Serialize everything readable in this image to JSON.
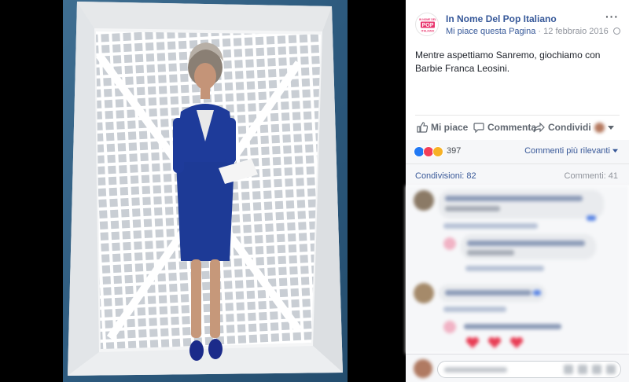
{
  "post": {
    "page_name": "In Nome Del Pop Italiano",
    "like_page": "Mi piace questa Pagina",
    "date": "12 febbraio 2016",
    "text_line1": "Mentre aspettiamo Sanremo, giochiamo con",
    "text_line2": "Barbie Franca Leosini.",
    "logo_lines": [
      "IN NOME DEL",
      "POP",
      "ITALIANO"
    ]
  },
  "actions": {
    "like": "Mi piace",
    "comment": "Commenta",
    "share": "Condividi"
  },
  "reactions": {
    "count": "397",
    "sort_label": "Commenti più rilevanti",
    "shares": "Condivisioni: 82",
    "comments": "Commenti: 41"
  },
  "icons": {
    "more": "more-options-icon",
    "like": "thumbs-up-icon",
    "comment": "speech-bubble-icon",
    "share": "share-arrow-icon",
    "audience": "globe-icon"
  },
  "colors": {
    "link_blue": "#365899",
    "panel_bg": "#f6f7f9",
    "like_blue": "#2078f4",
    "love_red": "#f33e58",
    "haha_yellow": "#f7b125",
    "logo_pink": "#e8356d"
  }
}
